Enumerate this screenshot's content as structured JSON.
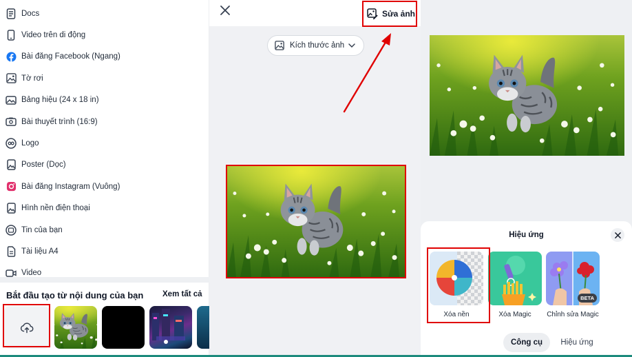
{
  "menu": {
    "items": [
      {
        "label": "Docs",
        "icon": "doc-icon"
      },
      {
        "label": "Video trên di động",
        "icon": "phone-icon"
      },
      {
        "label": "Bài đăng Facebook (Ngang)",
        "icon": "facebook-icon"
      },
      {
        "label": "Tờ rơi",
        "icon": "image-icon"
      },
      {
        "label": "Bảng hiệu (24 x 18 in)",
        "icon": "image-icon"
      },
      {
        "label": "Bài thuyết trình (16:9)",
        "icon": "presentation-icon"
      },
      {
        "label": "Logo",
        "icon": "logo-icon"
      },
      {
        "label": "Poster (Dọc)",
        "icon": "image-icon"
      },
      {
        "label": "Bài đăng Instagram (Vuông)",
        "icon": "instagram-icon"
      },
      {
        "label": "Hình nền điện thoại",
        "icon": "image-icon"
      },
      {
        "label": "Tin của bạn",
        "icon": "story-icon"
      },
      {
        "label": "Tài liệu A4",
        "icon": "doc-icon"
      },
      {
        "label": "Video",
        "icon": "video-icon"
      }
    ]
  },
  "start": {
    "title": "Bắt đầu tạo từ nội dung của bạn",
    "see_all": "Xem tất cả"
  },
  "editor": {
    "edit_photo_label": "Sửa ảnh",
    "size_label": "Kích thước ảnh"
  },
  "effects_sheet": {
    "title": "Hiệu ứng",
    "items": [
      {
        "label": "Xóa nền"
      },
      {
        "label": "Xóa Magic"
      },
      {
        "label": "Chỉnh sửa Magic",
        "badge": "BETA"
      }
    ],
    "tabs": [
      {
        "label": "Công cụ",
        "active": true
      },
      {
        "label": "Hiệu ứng",
        "active": false
      }
    ]
  },
  "colors": {
    "highlight": "#e00000",
    "facebook": "#1877f2",
    "accent_bottom": "#1c8a7c"
  }
}
